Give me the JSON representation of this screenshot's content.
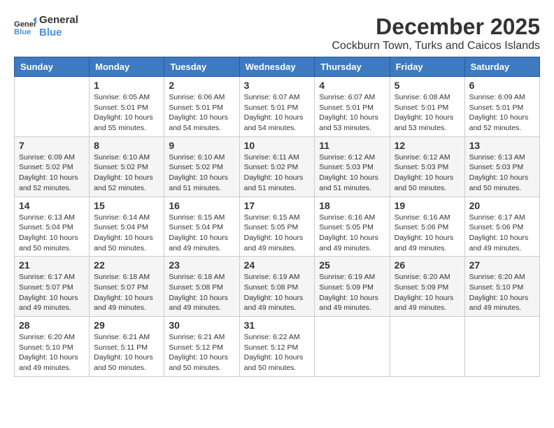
{
  "header": {
    "logo_general": "General",
    "logo_blue": "Blue",
    "month": "December 2025",
    "location": "Cockburn Town, Turks and Caicos Islands"
  },
  "weekdays": [
    "Sunday",
    "Monday",
    "Tuesday",
    "Wednesday",
    "Thursday",
    "Friday",
    "Saturday"
  ],
  "weeks": [
    [
      {
        "day": "",
        "sunrise": "",
        "sunset": "",
        "daylight": ""
      },
      {
        "day": "1",
        "sunrise": "Sunrise: 6:05 AM",
        "sunset": "Sunset: 5:01 PM",
        "daylight": "Daylight: 10 hours and 55 minutes."
      },
      {
        "day": "2",
        "sunrise": "Sunrise: 6:06 AM",
        "sunset": "Sunset: 5:01 PM",
        "daylight": "Daylight: 10 hours and 54 minutes."
      },
      {
        "day": "3",
        "sunrise": "Sunrise: 6:07 AM",
        "sunset": "Sunset: 5:01 PM",
        "daylight": "Daylight: 10 hours and 54 minutes."
      },
      {
        "day": "4",
        "sunrise": "Sunrise: 6:07 AM",
        "sunset": "Sunset: 5:01 PM",
        "daylight": "Daylight: 10 hours and 53 minutes."
      },
      {
        "day": "5",
        "sunrise": "Sunrise: 6:08 AM",
        "sunset": "Sunset: 5:01 PM",
        "daylight": "Daylight: 10 hours and 53 minutes."
      },
      {
        "day": "6",
        "sunrise": "Sunrise: 6:09 AM",
        "sunset": "Sunset: 5:01 PM",
        "daylight": "Daylight: 10 hours and 52 minutes."
      }
    ],
    [
      {
        "day": "7",
        "sunrise": "Sunrise: 6:09 AM",
        "sunset": "Sunset: 5:02 PM",
        "daylight": "Daylight: 10 hours and 52 minutes."
      },
      {
        "day": "8",
        "sunrise": "Sunrise: 6:10 AM",
        "sunset": "Sunset: 5:02 PM",
        "daylight": "Daylight: 10 hours and 52 minutes."
      },
      {
        "day": "9",
        "sunrise": "Sunrise: 6:10 AM",
        "sunset": "Sunset: 5:02 PM",
        "daylight": "Daylight: 10 hours and 51 minutes."
      },
      {
        "day": "10",
        "sunrise": "Sunrise: 6:11 AM",
        "sunset": "Sunset: 5:02 PM",
        "daylight": "Daylight: 10 hours and 51 minutes."
      },
      {
        "day": "11",
        "sunrise": "Sunrise: 6:12 AM",
        "sunset": "Sunset: 5:03 PM",
        "daylight": "Daylight: 10 hours and 51 minutes."
      },
      {
        "day": "12",
        "sunrise": "Sunrise: 6:12 AM",
        "sunset": "Sunset: 5:03 PM",
        "daylight": "Daylight: 10 hours and 50 minutes."
      },
      {
        "day": "13",
        "sunrise": "Sunrise: 6:13 AM",
        "sunset": "Sunset: 5:03 PM",
        "daylight": "Daylight: 10 hours and 50 minutes."
      }
    ],
    [
      {
        "day": "14",
        "sunrise": "Sunrise: 6:13 AM",
        "sunset": "Sunset: 5:04 PM",
        "daylight": "Daylight: 10 hours and 50 minutes."
      },
      {
        "day": "15",
        "sunrise": "Sunrise: 6:14 AM",
        "sunset": "Sunset: 5:04 PM",
        "daylight": "Daylight: 10 hours and 50 minutes."
      },
      {
        "day": "16",
        "sunrise": "Sunrise: 6:15 AM",
        "sunset": "Sunset: 5:04 PM",
        "daylight": "Daylight: 10 hours and 49 minutes."
      },
      {
        "day": "17",
        "sunrise": "Sunrise: 6:15 AM",
        "sunset": "Sunset: 5:05 PM",
        "daylight": "Daylight: 10 hours and 49 minutes."
      },
      {
        "day": "18",
        "sunrise": "Sunrise: 6:16 AM",
        "sunset": "Sunset: 5:05 PM",
        "daylight": "Daylight: 10 hours and 49 minutes."
      },
      {
        "day": "19",
        "sunrise": "Sunrise: 6:16 AM",
        "sunset": "Sunset: 5:06 PM",
        "daylight": "Daylight: 10 hours and 49 minutes."
      },
      {
        "day": "20",
        "sunrise": "Sunrise: 6:17 AM",
        "sunset": "Sunset: 5:06 PM",
        "daylight": "Daylight: 10 hours and 49 minutes."
      }
    ],
    [
      {
        "day": "21",
        "sunrise": "Sunrise: 6:17 AM",
        "sunset": "Sunset: 5:07 PM",
        "daylight": "Daylight: 10 hours and 49 minutes."
      },
      {
        "day": "22",
        "sunrise": "Sunrise: 6:18 AM",
        "sunset": "Sunset: 5:07 PM",
        "daylight": "Daylight: 10 hours and 49 minutes."
      },
      {
        "day": "23",
        "sunrise": "Sunrise: 6:18 AM",
        "sunset": "Sunset: 5:08 PM",
        "daylight": "Daylight: 10 hours and 49 minutes."
      },
      {
        "day": "24",
        "sunrise": "Sunrise: 6:19 AM",
        "sunset": "Sunset: 5:08 PM",
        "daylight": "Daylight: 10 hours and 49 minutes."
      },
      {
        "day": "25",
        "sunrise": "Sunrise: 6:19 AM",
        "sunset": "Sunset: 5:09 PM",
        "daylight": "Daylight: 10 hours and 49 minutes."
      },
      {
        "day": "26",
        "sunrise": "Sunrise: 6:20 AM",
        "sunset": "Sunset: 5:09 PM",
        "daylight": "Daylight: 10 hours and 49 minutes."
      },
      {
        "day": "27",
        "sunrise": "Sunrise: 6:20 AM",
        "sunset": "Sunset: 5:10 PM",
        "daylight": "Daylight: 10 hours and 49 minutes."
      }
    ],
    [
      {
        "day": "28",
        "sunrise": "Sunrise: 6:20 AM",
        "sunset": "Sunset: 5:10 PM",
        "daylight": "Daylight: 10 hours and 49 minutes."
      },
      {
        "day": "29",
        "sunrise": "Sunrise: 6:21 AM",
        "sunset": "Sunset: 5:11 PM",
        "daylight": "Daylight: 10 hours and 50 minutes."
      },
      {
        "day": "30",
        "sunrise": "Sunrise: 6:21 AM",
        "sunset": "Sunset: 5:12 PM",
        "daylight": "Daylight: 10 hours and 50 minutes."
      },
      {
        "day": "31",
        "sunrise": "Sunrise: 6:22 AM",
        "sunset": "Sunset: 5:12 PM",
        "daylight": "Daylight: 10 hours and 50 minutes."
      },
      {
        "day": "",
        "sunrise": "",
        "sunset": "",
        "daylight": ""
      },
      {
        "day": "",
        "sunrise": "",
        "sunset": "",
        "daylight": ""
      },
      {
        "day": "",
        "sunrise": "",
        "sunset": "",
        "daylight": ""
      }
    ]
  ]
}
